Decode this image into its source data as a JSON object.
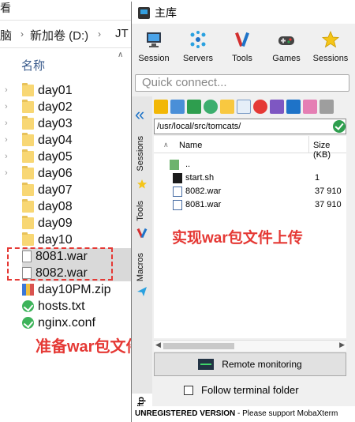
{
  "explorer": {
    "menu_text": "看",
    "address": [
      "脑",
      "新加卷 (D:)",
      "JT"
    ],
    "column_header": "名称",
    "items": [
      {
        "name": "day01",
        "type": "folder"
      },
      {
        "name": "day02",
        "type": "folder"
      },
      {
        "name": "day03",
        "type": "folder"
      },
      {
        "name": "day04",
        "type": "folder"
      },
      {
        "name": "day05",
        "type": "folder"
      },
      {
        "name": "day06",
        "type": "folder"
      },
      {
        "name": "day07",
        "type": "folder"
      },
      {
        "name": "day08",
        "type": "folder"
      },
      {
        "name": "day09",
        "type": "folder"
      },
      {
        "name": "day10",
        "type": "folder"
      },
      {
        "name": "8081.war",
        "type": "file",
        "selected": true
      },
      {
        "name": "8082.war",
        "type": "file",
        "selected": true
      },
      {
        "name": "day10PM.zip",
        "type": "zip"
      },
      {
        "name": "hosts.txt",
        "type": "green"
      },
      {
        "name": "nginx.conf",
        "type": "green"
      }
    ],
    "annotation": "准备war包文件"
  },
  "moba": {
    "title": "主库",
    "toolbar": [
      {
        "label": "Session",
        "icon": "session-icon"
      },
      {
        "label": "Servers",
        "icon": "servers-icon"
      },
      {
        "label": "Tools",
        "icon": "tools-icon"
      },
      {
        "label": "Games",
        "icon": "games-icon"
      },
      {
        "label": "Sessions",
        "icon": "star-icon"
      }
    ],
    "quick_connect": "Quick connect...",
    "side_tabs": {
      "sessions": "Sessions",
      "tools": "Tools",
      "macros": "Macros",
      "sftp": "Sftp"
    },
    "path": "/usr/local/src/tomcats/",
    "columns": {
      "name": "Name",
      "size": "Size (KB)"
    },
    "files": [
      {
        "name": "..",
        "size": "",
        "icon": "parent-folder-icon"
      },
      {
        "name": "start.sh",
        "size": "1",
        "icon": "terminal-icon"
      },
      {
        "name": "8082.war",
        "size": "37 910",
        "icon": "file-icon"
      },
      {
        "name": "8081.war",
        "size": "37 910",
        "icon": "file-icon"
      }
    ],
    "remote_monitoring": "Remote monitoring",
    "follow_terminal": "Follow terminal folder",
    "status_bold": "UNREGISTERED VERSION",
    "status_rest": " - Please support MobaXterm",
    "annotation": "实现war包文件上传"
  }
}
